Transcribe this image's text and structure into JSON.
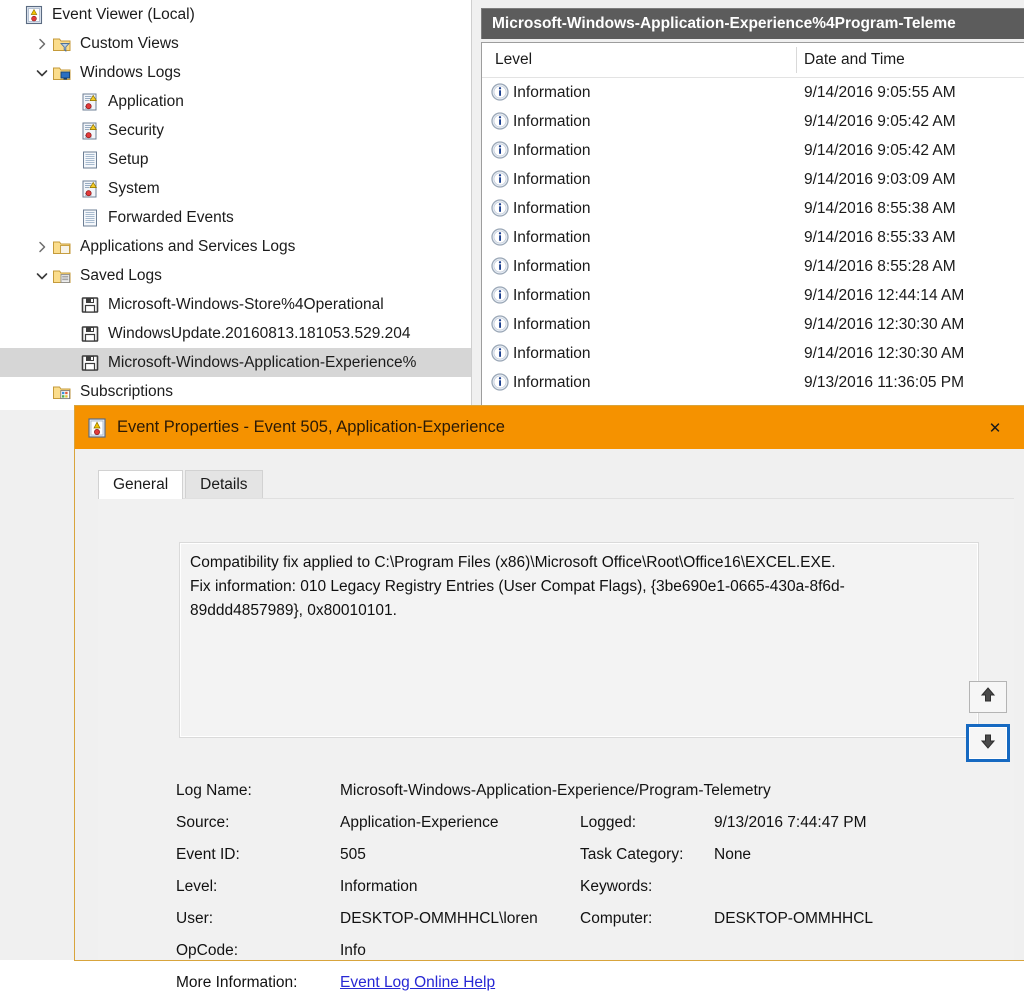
{
  "tree": {
    "items": [
      {
        "label": "Event Viewer (Local)",
        "indent": 0,
        "twisty": "none",
        "icon": "event-viewer-icon",
        "selected": false
      },
      {
        "label": "Custom Views",
        "indent": 1,
        "twisty": "collapsed",
        "icon": "folder-filter-icon",
        "selected": false
      },
      {
        "label": "Windows Logs",
        "indent": 1,
        "twisty": "expanded",
        "icon": "folder-computer-icon",
        "selected": false
      },
      {
        "label": "Application",
        "indent": 2,
        "twisty": "none",
        "icon": "log-warning-icon",
        "selected": false
      },
      {
        "label": "Security",
        "indent": 2,
        "twisty": "none",
        "icon": "log-warning-icon",
        "selected": false
      },
      {
        "label": "Setup",
        "indent": 2,
        "twisty": "none",
        "icon": "log-plain-icon",
        "selected": false
      },
      {
        "label": "System",
        "indent": 2,
        "twisty": "none",
        "icon": "log-warning-icon",
        "selected": false
      },
      {
        "label": "Forwarded Events",
        "indent": 2,
        "twisty": "none",
        "icon": "log-plain-icon",
        "selected": false
      },
      {
        "label": "Applications and Services Logs",
        "indent": 1,
        "twisty": "collapsed",
        "icon": "folder-icon",
        "selected": false
      },
      {
        "label": "Saved Logs",
        "indent": 1,
        "twisty": "expanded",
        "icon": "folder-log-icon",
        "selected": false
      },
      {
        "label": "Microsoft-Windows-Store%4Operational",
        "indent": 2,
        "twisty": "none",
        "icon": "saved-log-icon",
        "selected": false
      },
      {
        "label": "WindowsUpdate.20160813.181053.529.204",
        "indent": 2,
        "twisty": "none",
        "icon": "saved-log-icon",
        "selected": false
      },
      {
        "label": "Microsoft-Windows-Application-Experience%",
        "indent": 2,
        "twisty": "none",
        "icon": "saved-log-icon",
        "selected": true
      },
      {
        "label": "Subscriptions",
        "indent": 1,
        "twisty": "none",
        "icon": "subscriptions-icon",
        "selected": false
      }
    ]
  },
  "list": {
    "title": "Microsoft-Windows-Application-Experience%4Program-Teleme",
    "columns": [
      "Level",
      "Date and Time"
    ],
    "rows": [
      {
        "level": "Information",
        "date": "9/14/2016 9:05:55 AM",
        "icon": "information-icon"
      },
      {
        "level": "Information",
        "date": "9/14/2016 9:05:42 AM",
        "icon": "information-icon"
      },
      {
        "level": "Information",
        "date": "9/14/2016 9:05:42 AM",
        "icon": "information-icon"
      },
      {
        "level": "Information",
        "date": "9/14/2016 9:03:09 AM",
        "icon": "information-icon"
      },
      {
        "level": "Information",
        "date": "9/14/2016 8:55:38 AM",
        "icon": "information-icon"
      },
      {
        "level": "Information",
        "date": "9/14/2016 8:55:33 AM",
        "icon": "information-icon"
      },
      {
        "level": "Information",
        "date": "9/14/2016 8:55:28 AM",
        "icon": "information-icon"
      },
      {
        "level": "Information",
        "date": "9/14/2016 12:44:14 AM",
        "icon": "information-icon"
      },
      {
        "level": "Information",
        "date": "9/14/2016 12:30:30 AM",
        "icon": "information-icon"
      },
      {
        "level": "Information",
        "date": "9/14/2016 12:30:30 AM",
        "icon": "information-icon"
      },
      {
        "level": "Information",
        "date": "9/13/2016 11:36:05 PM",
        "icon": "information-icon"
      }
    ]
  },
  "dialog": {
    "title": "Event Properties - Event 505, Application-Experience",
    "titlebar_color": "#f59200",
    "close_label": "✕",
    "tabs": [
      {
        "label": "General",
        "active": true
      },
      {
        "label": "Details",
        "active": false
      }
    ],
    "description": "Compatibility fix applied to C:\\Program Files (x86)\\Microsoft Office\\Root\\Office16\\EXCEL.EXE.\nFix information: 010 Legacy Registry Entries (User Compat Flags), {3be690e1-0665-430a-8f6d-\n89ddd4857989}, 0x80010101.",
    "fields": {
      "log_name_label": "Log Name:",
      "log_name_value": "Microsoft-Windows-Application-Experience/Program-Telemetry",
      "source_label": "Source:",
      "source_value": "Application-Experience",
      "logged_label": "Logged:",
      "logged_value": "9/13/2016 7:44:47 PM",
      "event_id_label": "Event ID:",
      "event_id_value": "505",
      "task_category_label": "Task Category:",
      "task_category_value": "None",
      "level_label": "Level:",
      "level_value": "Information",
      "keywords_label": "Keywords:",
      "keywords_value": "",
      "user_label": "User:",
      "user_value": "DESKTOP-OMMHHCL\\loren",
      "computer_label": "Computer:",
      "computer_value": "DESKTOP-OMMHHCL",
      "opcode_label": "OpCode:",
      "opcode_value": "Info",
      "more_info_label": "More Information:",
      "more_info_link": "Event Log Online Help"
    },
    "nav": {
      "up_name": "previous-event-button",
      "down_name": "next-event-button"
    }
  }
}
